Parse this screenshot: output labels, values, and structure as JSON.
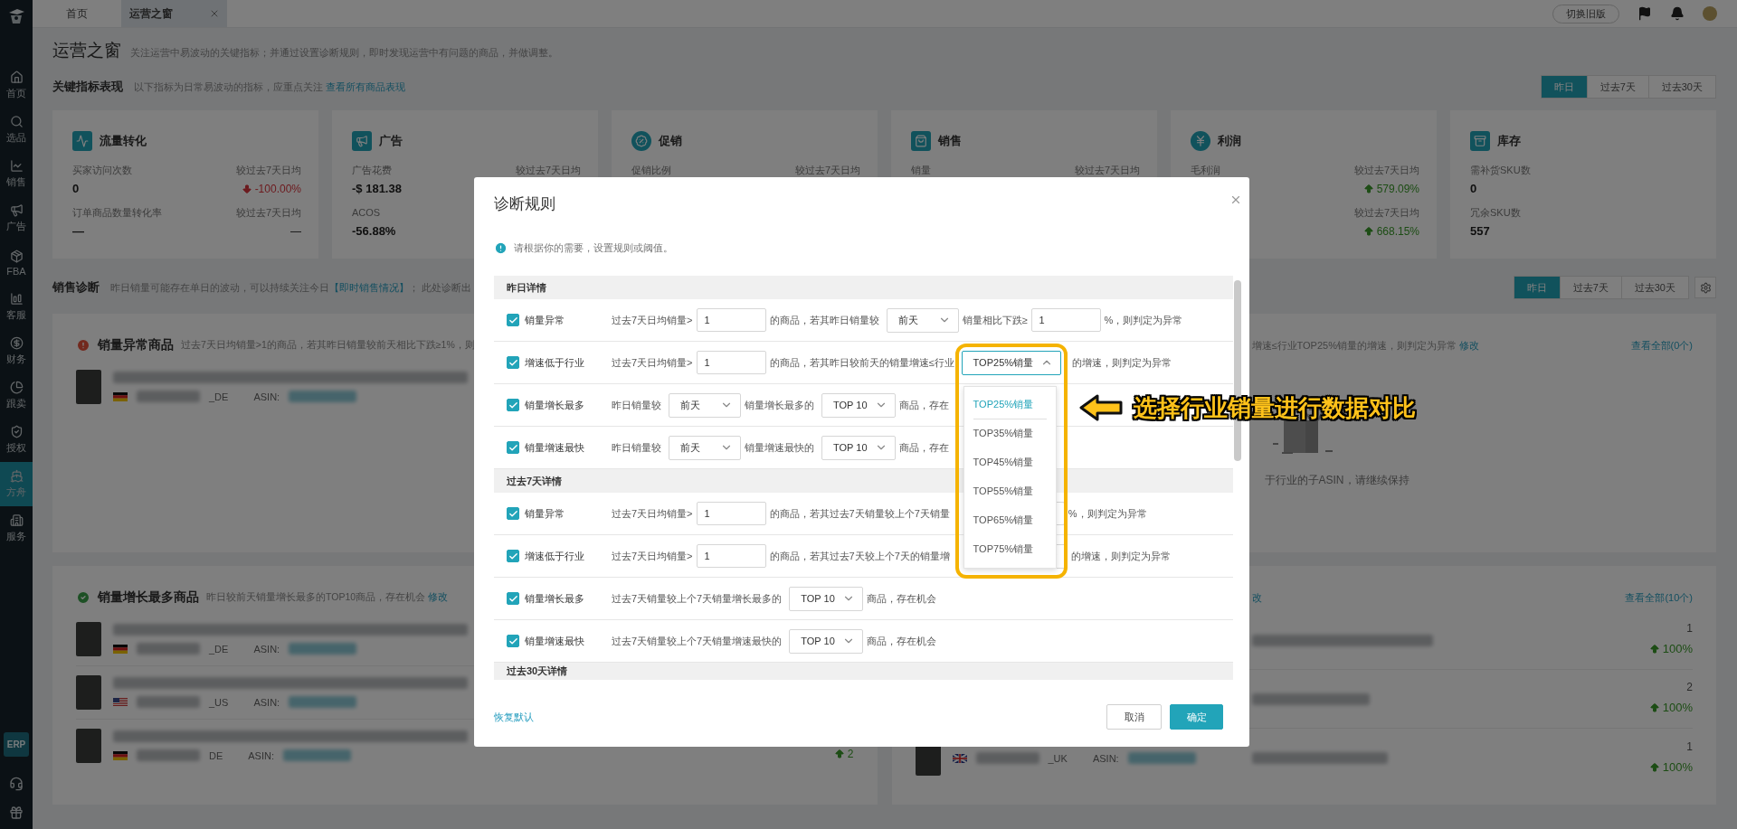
{
  "sidebar": {
    "items": [
      {
        "label": "首页",
        "selected": false
      },
      {
        "label": "选品",
        "selected": false
      },
      {
        "label": "销售",
        "selected": false
      },
      {
        "label": "广告",
        "selected": false
      },
      {
        "label": "FBA",
        "selected": false
      },
      {
        "label": "客服",
        "selected": false
      },
      {
        "label": "财务",
        "selected": false
      },
      {
        "label": "跟卖",
        "selected": false
      },
      {
        "label": "授权",
        "selected": false
      },
      {
        "label": "方舟",
        "selected": true
      },
      {
        "label": "服务",
        "selected": false
      }
    ],
    "badge": "ERP"
  },
  "top_bar": {
    "tabs": [
      {
        "label": "首页",
        "selected": false,
        "closable": false
      },
      {
        "label": "运营之窗",
        "selected": true,
        "closable": true
      }
    ],
    "switch_button": "切换旧版"
  },
  "page": {
    "title": "运营之窗",
    "description": "关注运营中易波动的关键指标；并通过设置诊断规则，即时发现运营中有问题的商品，并做调整。"
  },
  "key_metrics": {
    "title": "关键指标表现",
    "description": "以下指标为日常易波动的指标，应重点关注",
    "link": "查看所有商品表现",
    "periods": [
      {
        "label": "昨日",
        "selected": true
      },
      {
        "label": "过去7天",
        "selected": false
      },
      {
        "label": "过去30天",
        "selected": false
      }
    ],
    "cards": [
      {
        "title": "流量转化",
        "metrics": [
          {
            "label": "买家访问次数",
            "compare_label": "较过去7天日均",
            "value": "0",
            "change": "-100.00%",
            "kind": "down"
          },
          {
            "label": "订单商品数量转化率",
            "compare_label": "较过去7天日均",
            "value": "—",
            "change": "—",
            "kind": "flat"
          }
        ]
      },
      {
        "title": "广告",
        "metrics": [
          {
            "label": "广告花费",
            "compare_label": "较过去7天日均",
            "value": "-$ 181.38"
          },
          {
            "label": "ACOS",
            "value": "-56.88%"
          }
        ]
      },
      {
        "title": "促销",
        "metrics": [
          {
            "label": "促销比例",
            "compare_label": "较过去7天日均"
          }
        ]
      },
      {
        "title": "销售",
        "metrics": [
          {
            "label": "销量",
            "compare_label": "较过去7天日均"
          }
        ]
      },
      {
        "title": "利润",
        "metrics": [
          {
            "label": "毛利润",
            "compare_label": "较过去7天日均",
            "change": "579.09%",
            "kind": "up"
          },
          {
            "compare_label": "较过去7天日均",
            "change": "668.15%",
            "kind": "up"
          }
        ]
      },
      {
        "title": "库存",
        "metrics": [
          {
            "label": "需补货SKU数",
            "value": "0"
          },
          {
            "label": "冗余SKU数",
            "value": "557"
          }
        ]
      }
    ]
  },
  "diagnosis": {
    "title": "销售诊断",
    "description": "昨日销量可能存在单日的波动，可以持续关注今日",
    "link": "【即时销售情况】",
    "description_tail": "； 此处诊断出",
    "periods": [
      {
        "label": "昨日",
        "selected": true
      },
      {
        "label": "过去7天",
        "selected": false
      },
      {
        "label": "过去30天",
        "selected": false
      }
    ],
    "panels": [
      {
        "left": {
          "kind": "alert",
          "title": "销量异常商品",
          "description": "过去7天日均销量>1的商品，若其昨日销量较前天相比下跌≥1%，则",
          "products": [
            {
              "kind": "de",
              "market": "_DE",
              "asin_label": "ASIN:"
            }
          ]
        },
        "right": {
          "description": "增速≤行业TOP25%销量的增速，则判定为异常",
          "link": "修改",
          "view_all": "查看全部(0个)",
          "empty_text": "于行业的子ASIN，请继续保持"
        }
      },
      {
        "left": {
          "kind": "success",
          "title": "销量增长最多商品",
          "description": "昨日较前天销量增长最多的TOP10商品，存在机会",
          "link": "修改",
          "products": [
            {
              "kind": "de",
              "market": "_DE",
              "asin_label": "ASIN:"
            },
            {
              "kind": "us",
              "market": "_US",
              "asin_label": "ASIN:"
            },
            {
              "kind": "de",
              "market": "DE",
              "asin_label": "ASIN:",
              "change": "2"
            }
          ]
        },
        "right": {
          "link": "改",
          "view_all": "查看全部(10个)",
          "products": [
            {
              "count": "1",
              "change": "100%"
            },
            {
              "count": "2",
              "change": "100%"
            },
            {
              "kind": "uk",
              "market": "_UK",
              "asin_label": "ASIN:",
              "count": "1",
              "change": "100%"
            }
          ]
        }
      }
    ]
  },
  "dialog": {
    "title": "诊断规则",
    "notice": "请根据你的需要，设置规则或阈值。",
    "sections": [
      {
        "title": "昨日详情",
        "rules": [
          {
            "checked": true,
            "label": "销量异常",
            "parts": [
              {
                "kind": "text",
                "text": "过去7天日均销量>"
              },
              {
                "kind": "input",
                "value": "1"
              },
              {
                "kind": "text",
                "text": "的商品，若其昨日销量较"
              },
              {
                "kind": "select",
                "value": "前天",
                "open": false
              },
              {
                "kind": "text",
                "text": "销量相比下跌≥"
              },
              {
                "kind": "input",
                "value": "1"
              },
              {
                "kind": "text",
                "text": "%，则判定为异常"
              }
            ]
          },
          {
            "checked": true,
            "label": "增速低于行业",
            "parts": [
              {
                "kind": "text",
                "text": "过去7天日均销量>"
              },
              {
                "kind": "input",
                "value": "1"
              },
              {
                "kind": "text",
                "text": "的商品，若其昨日较前天的销量增速≤行业"
              },
              {
                "kind": "select",
                "value": "TOP25%销量",
                "open": true,
                "callout": "选择行业销量进行数据对比",
                "options": [
                  {
                    "label": "TOP25%销量",
                    "selected": true
                  },
                  {
                    "label": "TOP35%销量",
                    "selected": false
                  },
                  {
                    "label": "TOP45%销量",
                    "selected": false
                  },
                  {
                    "label": "TOP55%销量",
                    "selected": false
                  },
                  {
                    "label": "TOP65%销量",
                    "selected": false
                  },
                  {
                    "label": "TOP75%销量",
                    "selected": false
                  }
                ]
              },
              {
                "kind": "text",
                "text": "的增速，则判定为异常"
              }
            ]
          },
          {
            "checked": true,
            "label": "销量增长最多",
            "parts": [
              {
                "kind": "text",
                "text": "昨日销量较"
              },
              {
                "kind": "select",
                "value": "前天",
                "open": false
              },
              {
                "kind": "text",
                "text": "销量增长最多的"
              },
              {
                "kind": "select",
                "value": "TOP 10",
                "open": false
              },
              {
                "kind": "text",
                "text": "商品，存在"
              }
            ]
          },
          {
            "checked": true,
            "label": "销量增速最快",
            "parts": [
              {
                "kind": "text",
                "text": "昨日销量较"
              },
              {
                "kind": "select",
                "value": "前天",
                "open": false
              },
              {
                "kind": "text",
                "text": "销量增速最快的"
              },
              {
                "kind": "select",
                "value": "TOP 10",
                "open": false
              },
              {
                "kind": "text",
                "text": "商品，存在"
              }
            ]
          }
        ]
      },
      {
        "title": "过去7天详情",
        "rules": [
          {
            "checked": true,
            "label": "销量异常",
            "parts": [
              {
                "kind": "text",
                "text": "过去7天日均销量>"
              },
              {
                "kind": "input",
                "value": "1"
              },
              {
                "kind": "text",
                "text": "的商品，若其过去7天销量较上个7天销量"
              },
              {
                "kind": "input"
              },
              {
                "kind": "text",
                "text": "%，则判定为异常"
              }
            ]
          },
          {
            "checked": true,
            "label": "增速低于行业",
            "parts": [
              {
                "kind": "text",
                "text": "过去7天日均销量>"
              },
              {
                "kind": "input",
                "value": "1"
              },
              {
                "kind": "text",
                "text": "的商品，若其过去7天较上个7天的销量增"
              },
              {
                "kind": "select",
                "open": false
              },
              {
                "kind": "text",
                "text": "的增速，则判定为异常"
              }
            ]
          },
          {
            "checked": true,
            "label": "销量增长最多",
            "parts": [
              {
                "kind": "text",
                "text": "过去7天销量较上个7天销量增长最多的"
              },
              {
                "kind": "select",
                "value": "TOP 10",
                "open": false
              },
              {
                "kind": "text",
                "text": "商品，存在机会"
              }
            ]
          },
          {
            "checked": true,
            "label": "销量增速最快",
            "parts": [
              {
                "kind": "text",
                "text": "过去7天销量较上个7天销量增速最快的"
              },
              {
                "kind": "select",
                "value": "TOP 10",
                "open": false
              },
              {
                "kind": "text",
                "text": "商品，存在机会"
              }
            ]
          }
        ]
      },
      {
        "title": "过去30天详情"
      }
    ],
    "reset": "恢复默认",
    "cancel": "取消",
    "confirm": "确定"
  }
}
